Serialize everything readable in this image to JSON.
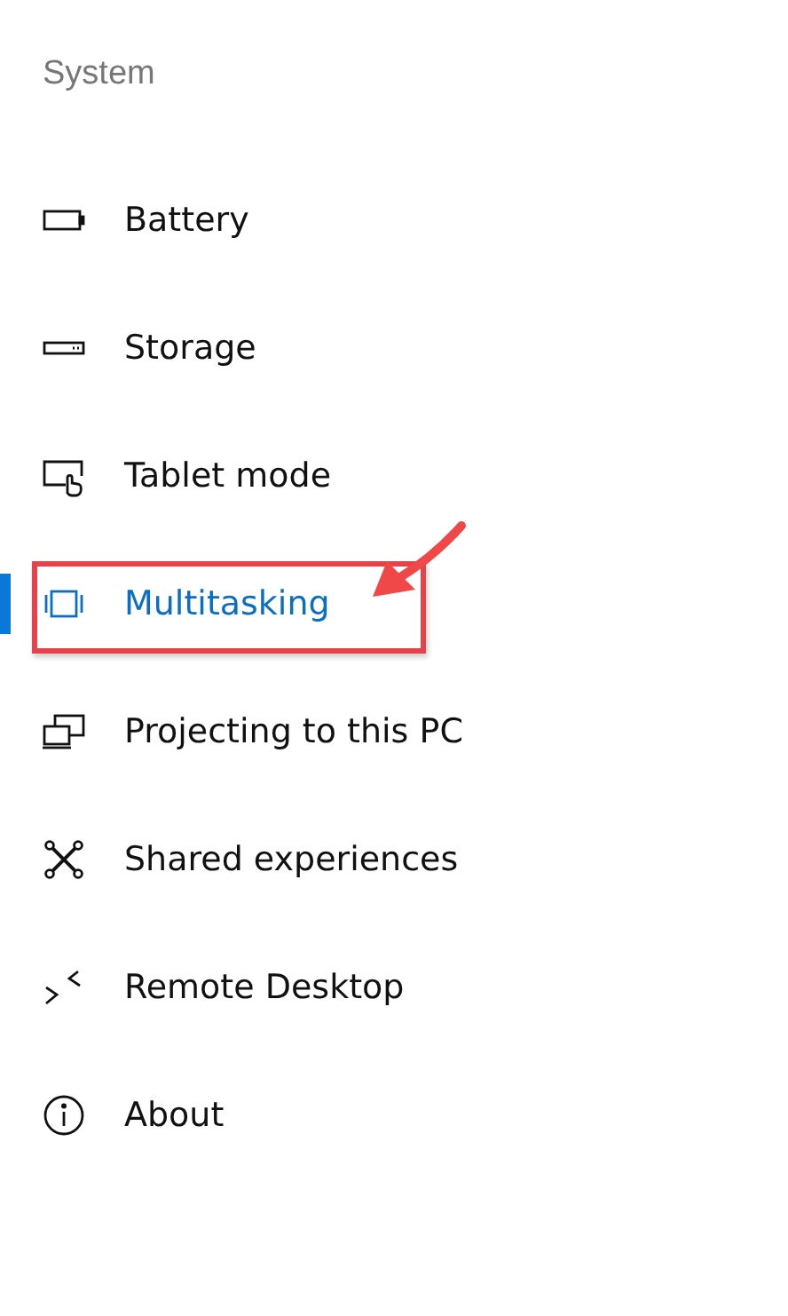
{
  "heading": "System",
  "items": [
    {
      "label": "Battery",
      "kind": "battery",
      "selected": false,
      "highlighted": false
    },
    {
      "label": "Storage",
      "kind": "storage",
      "selected": false,
      "highlighted": false
    },
    {
      "label": "Tablet mode",
      "kind": "tablet",
      "selected": false,
      "highlighted": false
    },
    {
      "label": "Multitasking",
      "kind": "multitask",
      "selected": true,
      "highlighted": true
    },
    {
      "label": "Projecting to this PC",
      "kind": "project",
      "selected": false,
      "highlighted": false
    },
    {
      "label": "Shared experiences",
      "kind": "shared",
      "selected": false,
      "highlighted": false
    },
    {
      "label": "Remote Desktop",
      "kind": "remote",
      "selected": false,
      "highlighted": false
    },
    {
      "label": "About",
      "kind": "about",
      "selected": false,
      "highlighted": false
    }
  ]
}
